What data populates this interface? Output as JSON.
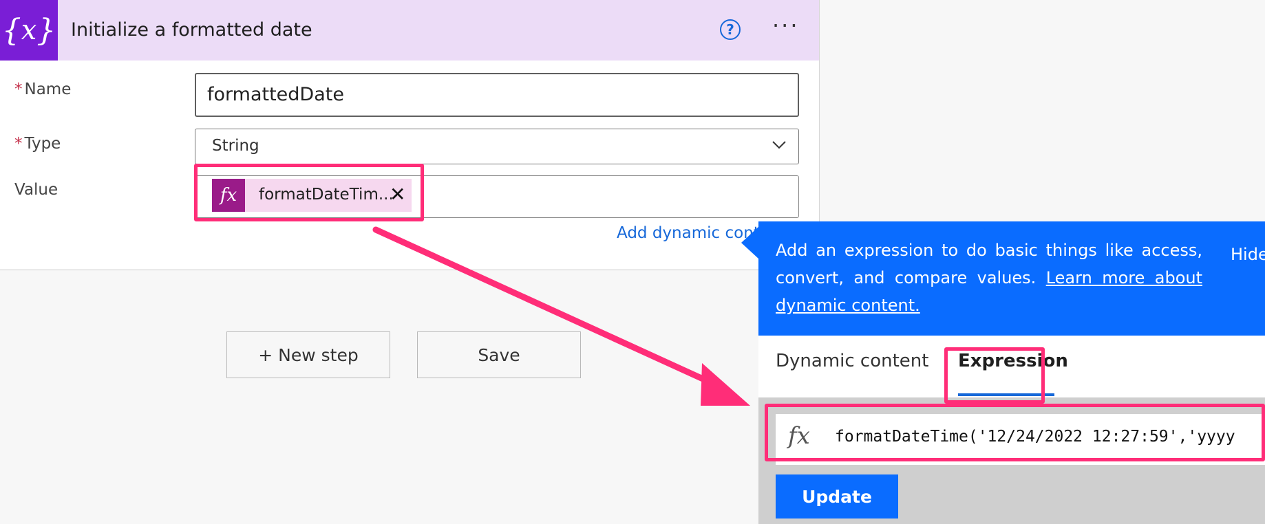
{
  "card": {
    "title": "Initialize a formatted date",
    "header_icon": "variable-icon",
    "help_icon": "help-circle-icon",
    "more_icon": "more-ellipsis-icon"
  },
  "form": {
    "required_marker": "*",
    "name_label": "Name",
    "name_value": "formattedDate",
    "type_label": "Type",
    "type_value": "String",
    "value_label": "Value",
    "token_text": "formatDateTim...",
    "add_dynamic": "Add dynamic conte"
  },
  "buttons": {
    "new_step": "+ New step",
    "save": "Save"
  },
  "popup": {
    "info_text": "Add an expression to do basic things like access, convert, and compare values.",
    "learn_more": "Learn more about dynamic content.",
    "hide": "Hide",
    "tab_dynamic": "Dynamic content",
    "tab_expression": "Expression",
    "expression": "formatDateTime('12/24/2022 12:27:59','yyyy",
    "update": "Update"
  },
  "colors": {
    "highlight": "#ff2d78",
    "accent_blue": "#0a6cff",
    "variable_purple": "#7a1ed6",
    "token_magenta": "#9a1b89",
    "header_lavender": "#ecdcf7"
  }
}
